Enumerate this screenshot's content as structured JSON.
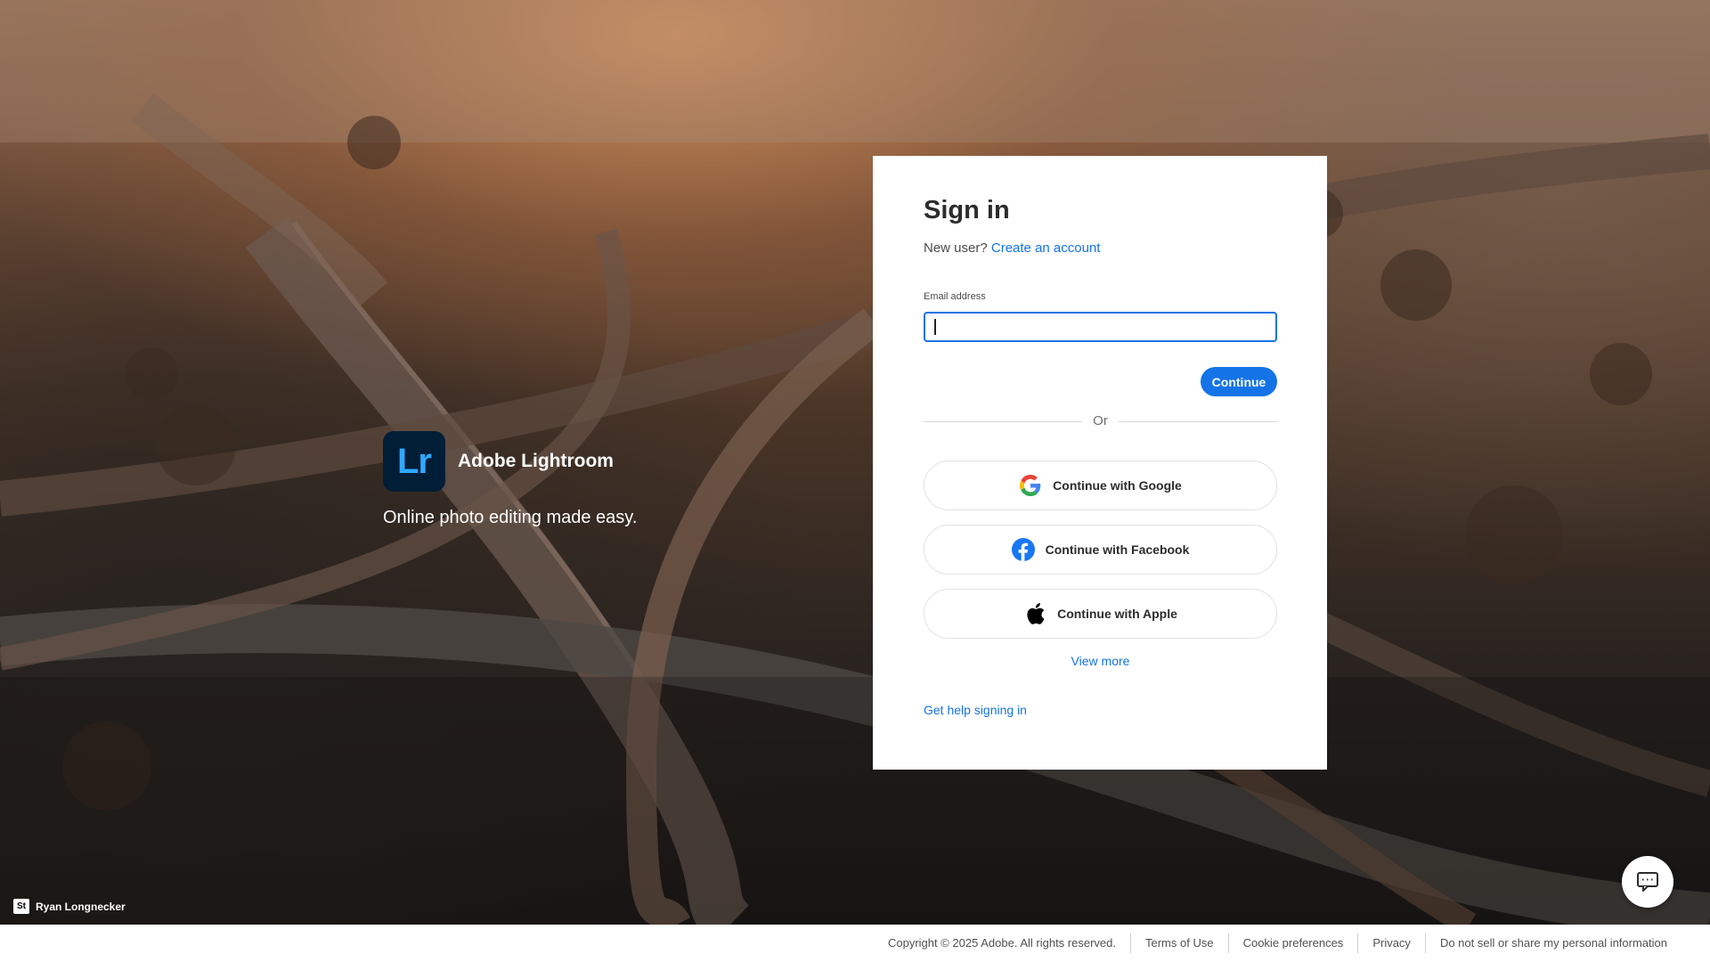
{
  "brand": {
    "logo_text": "Lr",
    "name": "Adobe Lightroom",
    "tagline": "Online photo editing made easy."
  },
  "signin": {
    "title": "Sign in",
    "new_user_prefix": "New user?",
    "create_account": "Create an account",
    "email_label": "Email address",
    "email_value": "",
    "continue_label": "Continue",
    "or_label": "Or",
    "social": [
      {
        "label": "Continue with Google",
        "icon": "google-icon"
      },
      {
        "label": "Continue with Facebook",
        "icon": "facebook-icon"
      },
      {
        "label": "Continue with Apple",
        "icon": "apple-icon"
      }
    ],
    "view_more": "View more",
    "help": "Get help signing in"
  },
  "credit": {
    "badge": "St",
    "name": "Ryan Longnecker"
  },
  "chat": {
    "icon": "chat-icon"
  },
  "footer": {
    "items": [
      "Copyright © 2025 Adobe. All rights reserved.",
      "Terms of Use",
      "Cookie preferences",
      "Privacy",
      "Do not sell or share my personal information"
    ]
  },
  "colors": {
    "accent": "#1473e6",
    "lr_bg": "#001e36",
    "lr_text": "#31a8ff",
    "facebook": "#1877f2"
  }
}
